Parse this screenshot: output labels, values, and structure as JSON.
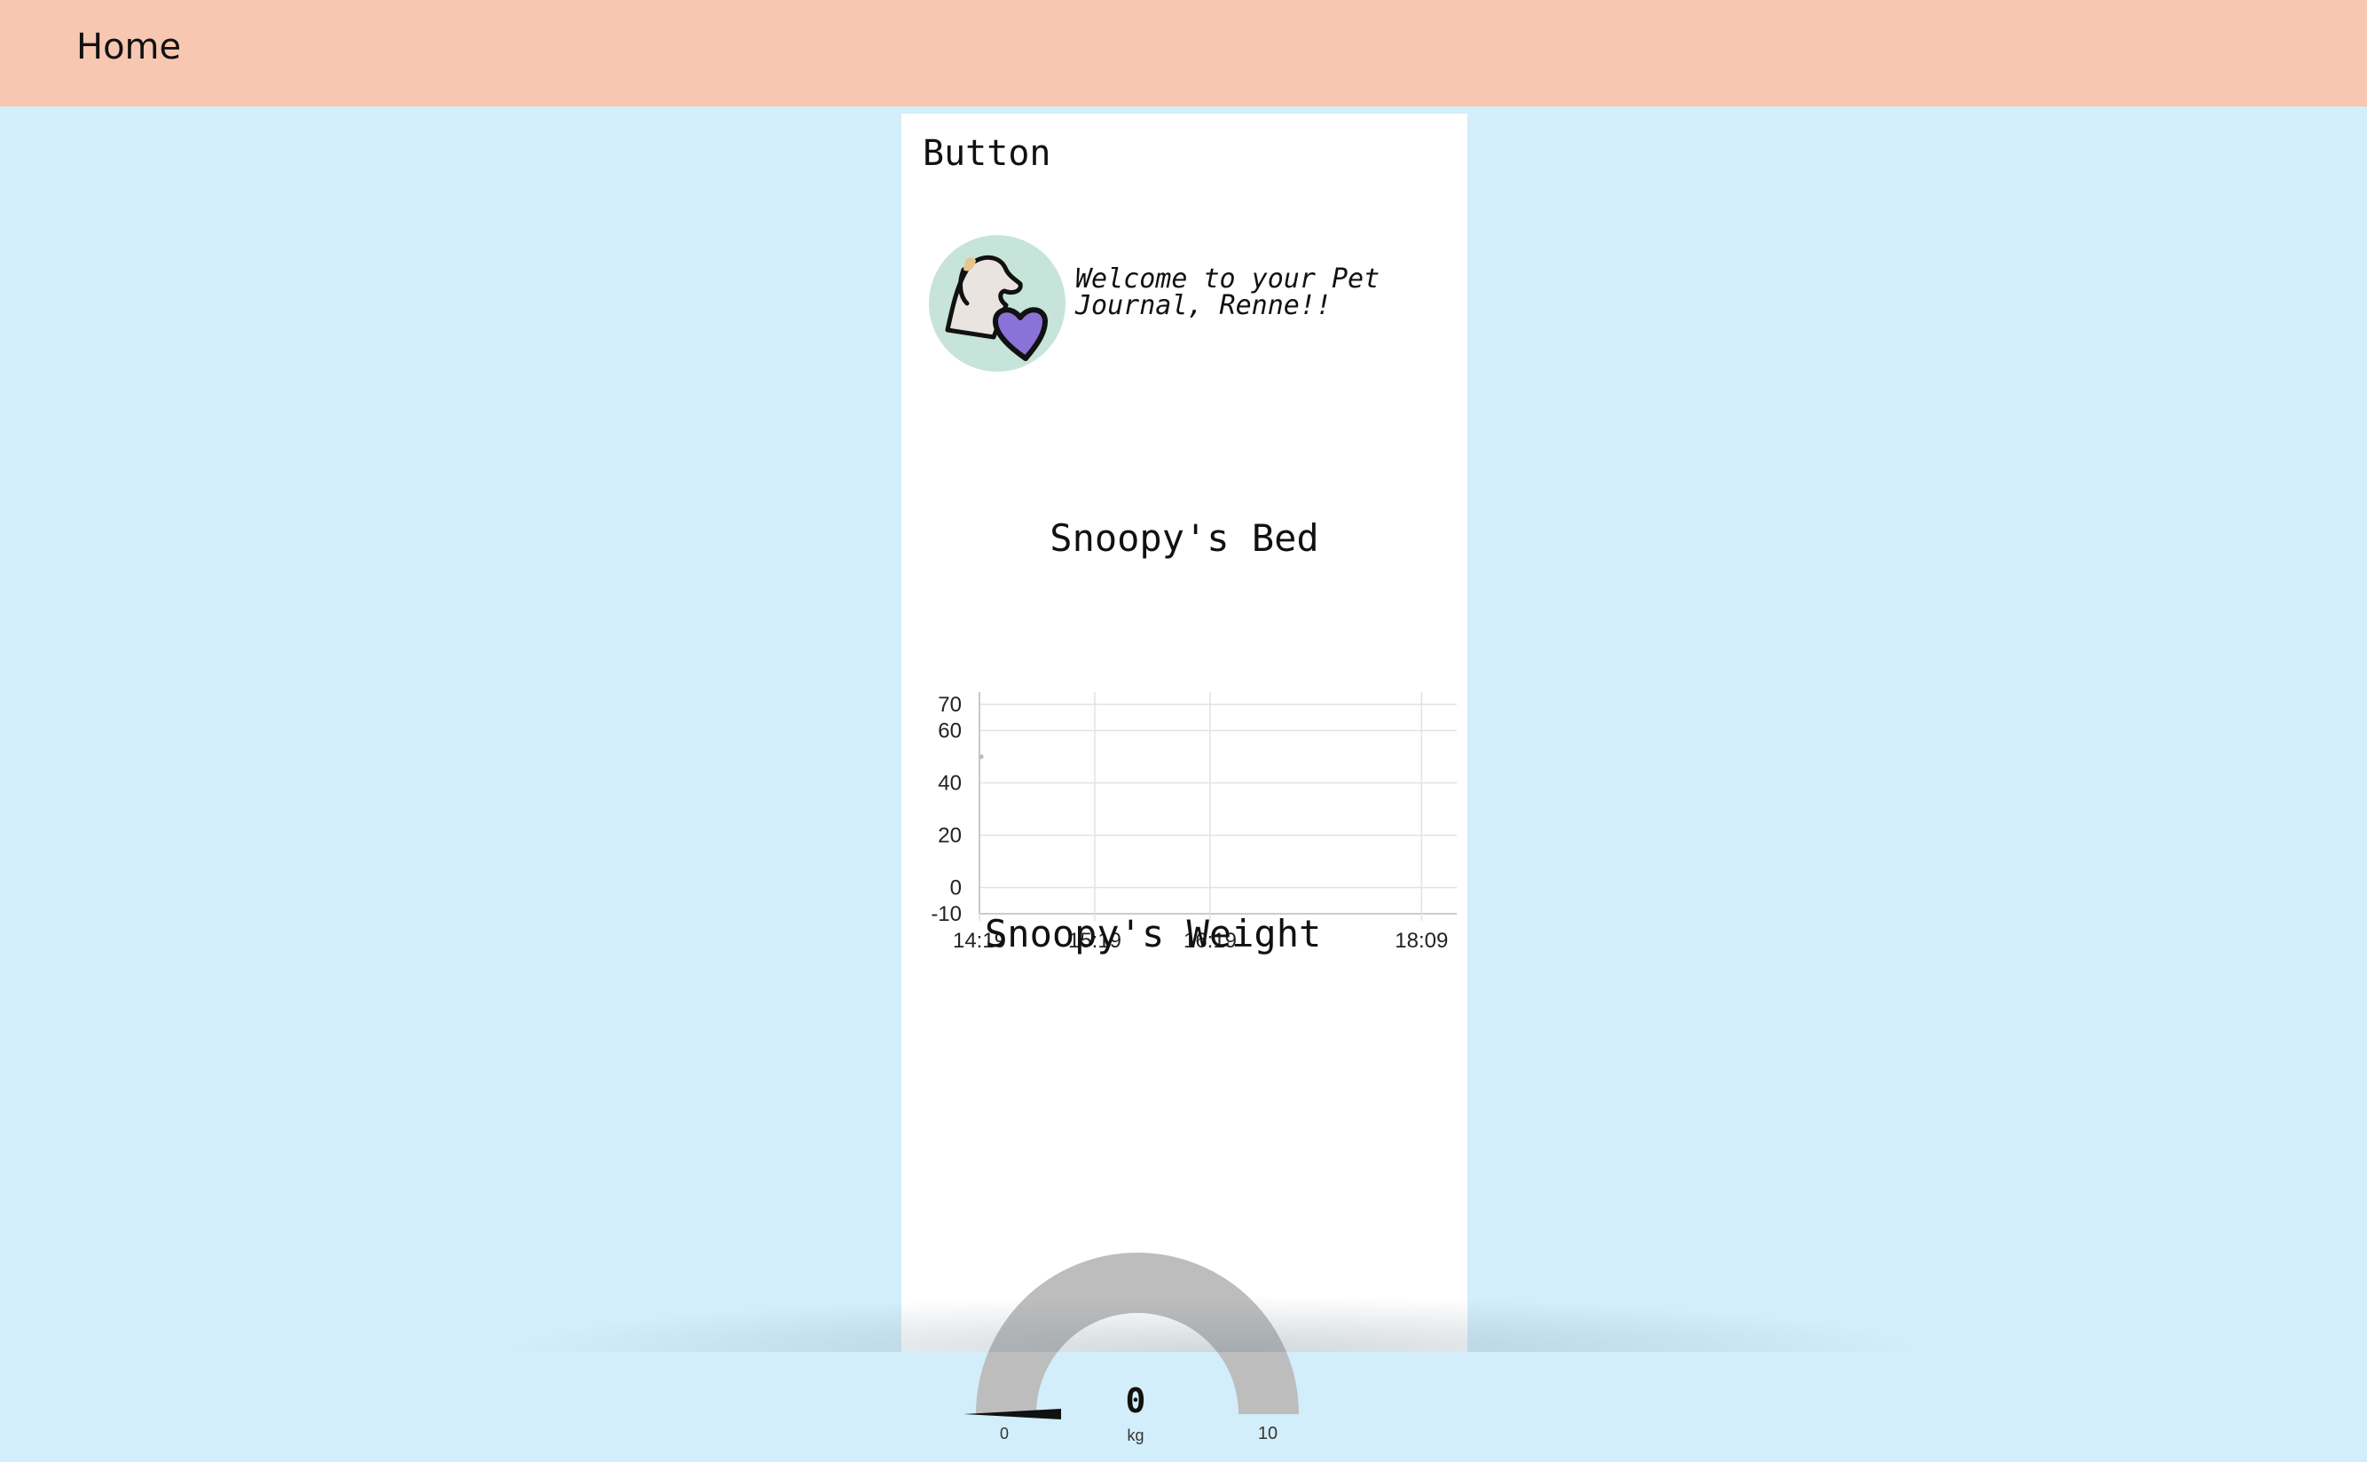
{
  "header": {
    "title": "Home"
  },
  "card": {
    "button_label": "Button",
    "avatar_icon": "dog-heart-icon",
    "welcome_text": "Welcome to your Pet Journal, Renne!!"
  },
  "bed_chart": {
    "title": "Snoopy's Bed",
    "chart_data": {
      "type": "scatter",
      "title": "Snoopy's Bed",
      "xlabel": "",
      "ylabel": "",
      "x_ticks": [
        "14:19",
        "15:19",
        "16:19",
        "18:09"
      ],
      "y_ticks": [
        70,
        60,
        40,
        20,
        0,
        -10
      ],
      "ylim": [
        -10,
        70
      ],
      "grid": true,
      "series": [
        {
          "x": [
            "14:20"
          ],
          "values": [
            50
          ]
        }
      ]
    }
  },
  "weight_gauge": {
    "title": "Snoopy's Weight",
    "value": "0",
    "unit": "kg",
    "min": "0",
    "max": "10",
    "level": 0
  }
}
